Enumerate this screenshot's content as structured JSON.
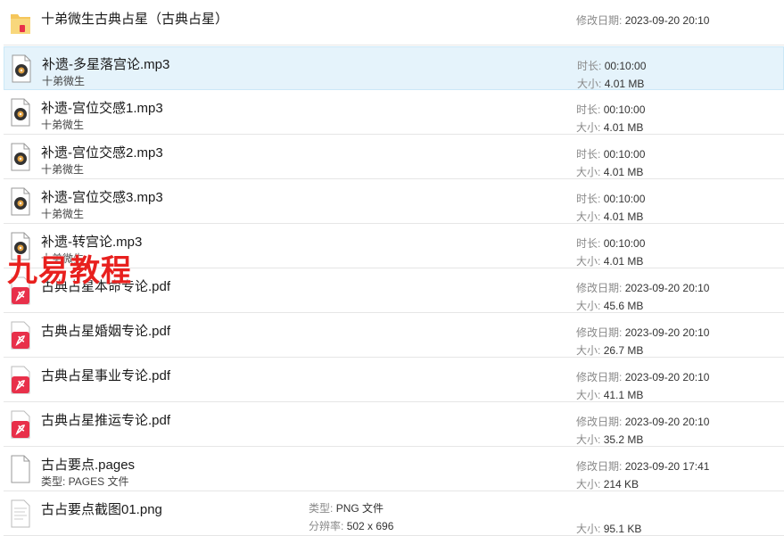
{
  "labels": {
    "modified": "修改日期:",
    "duration": "时长:",
    "size": "大小:",
    "type": "类型:",
    "resolution": "分辨率:"
  },
  "items": [
    {
      "kind": "folder",
      "name": "十弟微生古典占星（古典占星）",
      "modified": "2023-09-20 20:10"
    },
    {
      "kind": "mp3",
      "name": "补遗-多星落宫论.mp3",
      "sub": "十弟微生",
      "duration": "00:10:00",
      "size": "4.01 MB",
      "selected": true
    },
    {
      "kind": "mp3",
      "name": "补遗-宫位交感1.mp3",
      "sub": "十弟微生",
      "duration": "00:10:00",
      "size": "4.01 MB"
    },
    {
      "kind": "mp3",
      "name": "补遗-宫位交感2.mp3",
      "sub": "十弟微生",
      "duration": "00:10:00",
      "size": "4.01 MB"
    },
    {
      "kind": "mp3",
      "name": "补遗-宫位交感3.mp3",
      "sub": "十弟微生",
      "duration": "00:10:00",
      "size": "4.01 MB"
    },
    {
      "kind": "mp3",
      "name": "补遗-转宫论.mp3",
      "sub": "十弟微生",
      "duration": "00:10:00",
      "size": "4.01 MB"
    },
    {
      "kind": "pdf",
      "name": "古典占星本命专论.pdf",
      "modified": "2023-09-20 20:10",
      "size": "45.6 MB"
    },
    {
      "kind": "pdf",
      "name": "古典占星婚姻专论.pdf",
      "modified": "2023-09-20 20:10",
      "size": "26.7 MB"
    },
    {
      "kind": "pdf",
      "name": "古典占星事业专论.pdf",
      "modified": "2023-09-20 20:10",
      "size": "41.1 MB"
    },
    {
      "kind": "pdf",
      "name": "古典占星推运专论.pdf",
      "modified": "2023-09-20 20:10",
      "size": "35.2 MB"
    },
    {
      "kind": "pages",
      "name": "古占要点.pages",
      "sub": "类型: PAGES 文件",
      "modified": "2023-09-20 17:41",
      "size": "214 KB"
    },
    {
      "kind": "png",
      "name": "古占要点截图01.png",
      "type": "PNG 文件",
      "resolution": "502 x 696",
      "size": "95.1 KB"
    }
  ],
  "watermark": "九易教程",
  "colors": {
    "selected_bg": "#e5f3fb",
    "pdf_red": "#e8304a",
    "folder": "#f5c65b",
    "watermark": "#e8201e"
  }
}
